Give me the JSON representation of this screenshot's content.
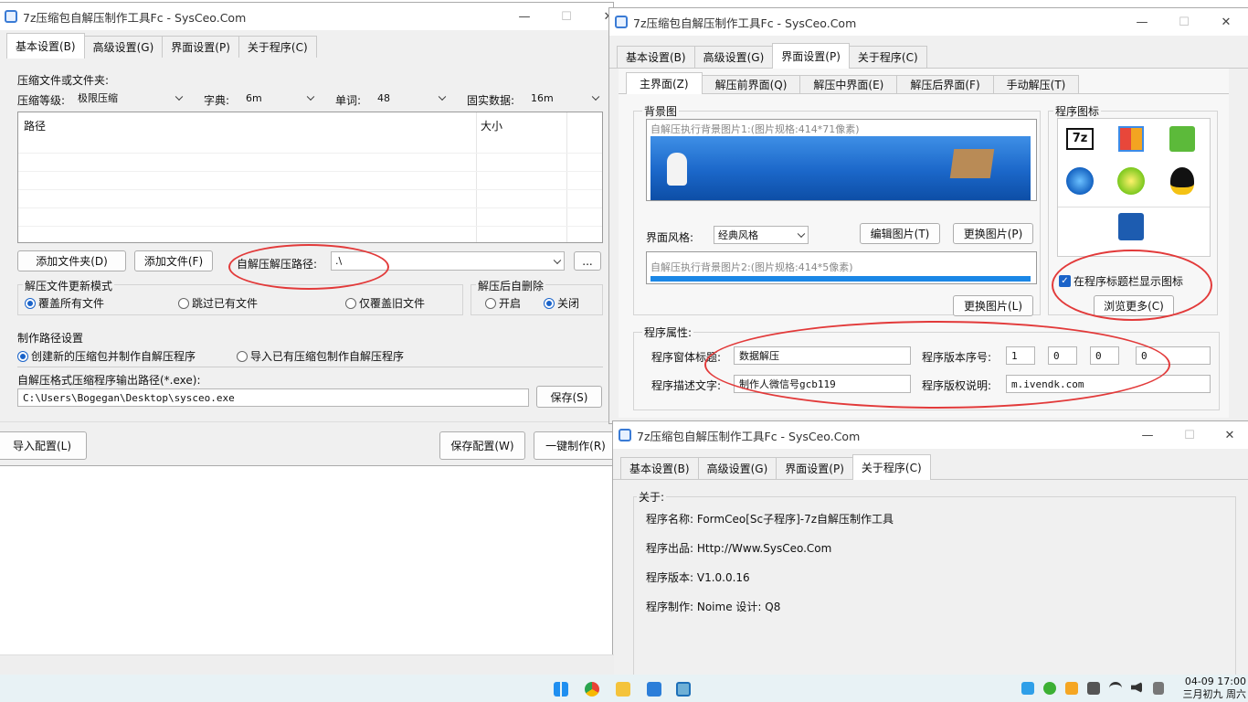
{
  "window1": {
    "title": "7z压缩包自解压制作工具Fc - SysCeo.Com",
    "tabs": [
      "基本设置(B)",
      "高级设置(G)",
      "界面设置(P)",
      "关于程序(C)"
    ],
    "section_label": "压缩文件或文件夹:",
    "level_label": "压缩等级:",
    "level_value": "极限压缩",
    "dict_label": "字典:",
    "dict_value": "6m",
    "word_label": "单词:",
    "word_value": "48",
    "solid_label": "固实数据:",
    "solid_value": "16m",
    "col_path": "路径",
    "col_size": "大小",
    "btn_add_folder": "添加文件夹(D)",
    "btn_add_file": "添加文件(F)",
    "extract_path_label": "自解压解压路径:",
    "extract_path_value": ".\\",
    "btn_browse": "...",
    "update_mode_title": "解压文件更新模式",
    "update_options": [
      "覆盖所有文件",
      "跳过已有文件",
      "仅覆盖旧文件"
    ],
    "autodelete_title": "解压后自删除",
    "autodelete_options": [
      "开启",
      "关闭"
    ],
    "make_path_title": "制作路径设置",
    "make_options": [
      "创建新的压缩包并制作自解压程序",
      "导入已有压缩包制作自解压程序"
    ],
    "output_label": "自解压格式压缩程序输出路径(*.exe):",
    "output_value": "C:\\Users\\Bogegan\\Desktop\\sysceo.exe",
    "btn_save": "保存(S)",
    "btn_import": "导入配置(L)",
    "btn_save_config": "保存配置(W)",
    "btn_make": "一键制作(R)"
  },
  "window2": {
    "title": "7z压缩包自解压制作工具Fc - SysCeo.Com",
    "tabs": [
      "基本设置(B)",
      "高级设置(G)",
      "界面设置(P)",
      "关于程序(C)"
    ],
    "subtabs": [
      "主界面(Z)",
      "解压前界面(Q)",
      "解压中界面(E)",
      "解压后界面(F)",
      "手动解压(T)"
    ],
    "bg_title": "背景图",
    "bg1_caption": "自解压执行背景图片1:(图片规格:414*71像素)",
    "style_label": "界面风格:",
    "style_value": "经典风格",
    "btn_edit_image": "编辑图片(T)",
    "btn_change_image": "更换图片(P)",
    "bg2_caption": "自解压执行背景图片2:(图片规格:414*5像素)",
    "btn_change_image2": "更换图片(L)",
    "icon_title": "程序图标",
    "icons": [
      "7z-icon",
      "office-icon",
      "soft-icon",
      "windows-icon",
      "music-icon",
      "qq-icon",
      "zip-icon"
    ],
    "show_icon_label": "在程序标题栏显示图标",
    "btn_browse_more": "浏览更多(C)",
    "props_title": "程序属性:",
    "window_title_label": "程序窗体标题:",
    "window_title_value": "数据解压",
    "version_label": "程序版本序号:",
    "version_values": [
      "1",
      "0",
      "0",
      "0"
    ],
    "desc_label": "程序描述文字:",
    "desc_value": "制作人微信号gcb119",
    "copyright_label": "程序版权说明:",
    "copyright_value": "m.ivendk.com"
  },
  "window3": {
    "title": "7z压缩包自解压制作工具Fc - SysCeo.Com",
    "tabs": [
      "基本设置(B)",
      "高级设置(G)",
      "界面设置(P)",
      "关于程序(C)"
    ],
    "about_title": "关于:",
    "name_line": "程序名称: FormCeo[Sc子程序]-7z自解压制作工具",
    "publisher_line": "程序出品: Http://Www.SysCeo.Com",
    "version_line": "程序版本: V1.0.0.16",
    "maker_line": "程序制作: Noime  设计: Q8"
  },
  "taskbar": {
    "time": "04-09 17:00",
    "date": "三月初九 周六"
  },
  "colors": {
    "accent": "#1a63c9",
    "annotation": "#e23a3a"
  }
}
